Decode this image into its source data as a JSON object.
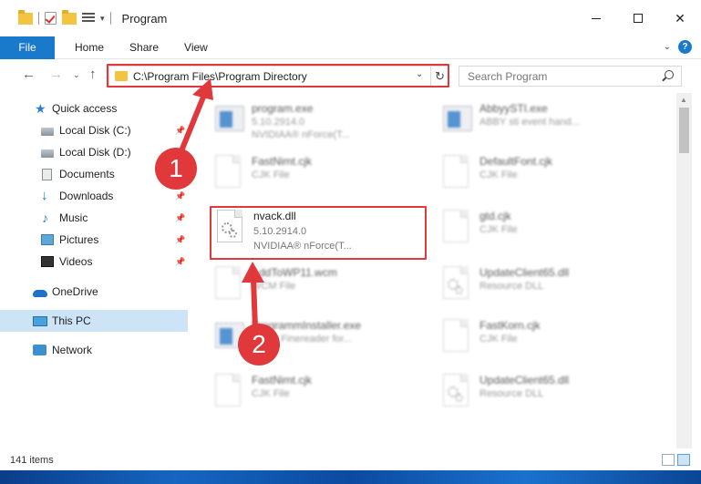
{
  "window": {
    "title": "Program",
    "minimize_label": "",
    "close_label": "✕"
  },
  "ribbon": {
    "file_tab": "File",
    "tabs": [
      "Home",
      "Share",
      "View"
    ],
    "help_label": "?"
  },
  "address": {
    "path": "C:\\Program Files\\Program Directory",
    "search_placeholder": "Search Program"
  },
  "sidebar": {
    "items": [
      {
        "label": "Quick access",
        "icon": "star-icon",
        "pinned": false
      },
      {
        "label": "Local Disk (C:)",
        "icon": "drive-icon",
        "pinned": true
      },
      {
        "label": "Local Disk (D:)",
        "icon": "drive-icon",
        "pinned": false
      },
      {
        "label": "Documents",
        "icon": "document-icon",
        "pinned": true
      },
      {
        "label": "Downloads",
        "icon": "download-icon",
        "pinned": true
      },
      {
        "label": "Music",
        "icon": "music-icon",
        "pinned": true
      },
      {
        "label": "Pictures",
        "icon": "pictures-icon",
        "pinned": true
      },
      {
        "label": "Videos",
        "icon": "videos-icon",
        "pinned": true
      },
      {
        "label": "OneDrive",
        "icon": "cloud-icon",
        "pinned": false
      },
      {
        "label": "This PC",
        "icon": "computer-icon",
        "pinned": false,
        "selected": true
      },
      {
        "label": "Network",
        "icon": "network-icon",
        "pinned": false
      }
    ]
  },
  "files": {
    "left": [
      {
        "name": "program.exe",
        "line2": "5.10.2914.0",
        "line3": "NVIDIAA® nForce(T...",
        "type": "exe"
      },
      {
        "name": "FastNimt.cjk",
        "line2": "CJK File",
        "line3": "",
        "type": "doc"
      },
      {
        "name": "nvack.dll",
        "line2": "5.10.2914.0",
        "line3": "NVIDIAA® nForce(T...",
        "type": "dll"
      },
      {
        "name": "AddToWP11.wcm",
        "line2": "WCM File",
        "line3": "",
        "type": "doc"
      },
      {
        "name": "ProgrammInstaller.exe",
        "line2": "ABBY Finereader for...",
        "line3": "",
        "type": "exe"
      },
      {
        "name": "FastNimt.cjk",
        "line2": "CJK File",
        "line3": "",
        "type": "doc"
      }
    ],
    "right": [
      {
        "name": "AbbyySTI.exe",
        "line2": "ABBY sti event hand...",
        "type": "exe"
      },
      {
        "name": "DefaultFont.cjk",
        "line2": "CJK File",
        "type": "doc"
      },
      {
        "name": "gtd.cjk",
        "line2": "CJK File",
        "type": "doc"
      },
      {
        "name": "UpdateClient65.dll",
        "line2": "Resource DLL",
        "type": "dll"
      },
      {
        "name": "FastKorn.cjk",
        "line2": "CJK File",
        "type": "doc"
      },
      {
        "name": "UpdateClient65.dll",
        "line2": "Resource DLL",
        "type": "dll"
      }
    ]
  },
  "status": {
    "item_count": "141 items"
  },
  "callouts": [
    "1",
    "2"
  ],
  "colors": {
    "accent": "#1979ca",
    "highlight": "#e0383b",
    "selected_bg": "#cde4f7"
  }
}
